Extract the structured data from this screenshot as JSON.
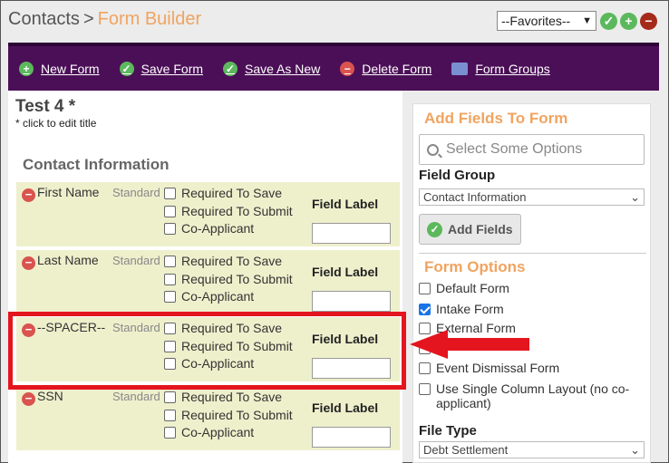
{
  "breadcrumb": {
    "parent": "Contacts",
    "separator": ">",
    "current": "Form Builder"
  },
  "favorites": {
    "selected": "--Favorites--"
  },
  "toolbar": {
    "new_form": "New Form",
    "save_form": "Save Form",
    "save_as_new": "Save As New",
    "delete_form": "Delete Form",
    "form_groups": "Form Groups"
  },
  "form": {
    "title": "Test 4 *",
    "hint": "* click to edit title",
    "section": "Contact Information"
  },
  "field_label_heading": "Field Label",
  "option_labels": {
    "save": "Required To Save",
    "submit": "Required To Submit",
    "coapp": "Co-Applicant"
  },
  "fields": [
    {
      "name": "First Name",
      "type": "Standard"
    },
    {
      "name": "Last Name",
      "type": "Standard"
    },
    {
      "name": "--SPACER--",
      "type": "Standard"
    },
    {
      "name": "SSN",
      "type": "Standard"
    }
  ],
  "panel": {
    "add_fields_title": "Add Fields To Form",
    "search_placeholder": "Select Some Options",
    "field_group_label": "Field Group",
    "field_group_value": "Contact Information",
    "add_fields_button": "Add Fields",
    "form_options_title": "Form Options",
    "options": [
      {
        "label": "Default Form",
        "checked": false
      },
      {
        "label": "Intake Form",
        "checked": true
      },
      {
        "label": "External Form",
        "checked": false
      },
      {
        "label": "",
        "checked": false
      },
      {
        "label": "Event Dismissal Form",
        "checked": false
      },
      {
        "label": "Use Single Column Layout (no co-applicant)",
        "checked": false
      }
    ],
    "file_type_label": "File Type",
    "file_type_value": "Debt Settlement"
  },
  "colors": {
    "accent": "#f0a460",
    "toolbar": "#4b0f57",
    "highlight": "#e4151f",
    "row_bg": "#eef0cc"
  }
}
